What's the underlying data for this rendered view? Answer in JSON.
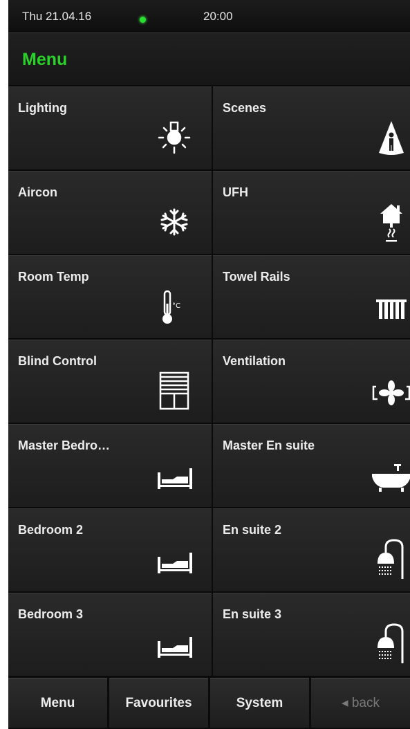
{
  "status": {
    "date": "Thu 21.04.16",
    "time": "20:00",
    "indicator_color": "#27e030"
  },
  "header": {
    "title": "Menu",
    "title_color": "#2ad12a"
  },
  "tiles": [
    {
      "label": "Lighting",
      "icon": "light-bulb-icon"
    },
    {
      "label": "Scenes",
      "icon": "scene-spotlight-icon"
    },
    {
      "label": "Aircon",
      "icon": "snowflake-icon"
    },
    {
      "label": "UFH",
      "icon": "underfloor-heating-icon"
    },
    {
      "label": "Room Temp",
      "icon": "thermometer-icon"
    },
    {
      "label": "Towel Rails",
      "icon": "towel-rail-icon"
    },
    {
      "label": "Blind Control",
      "icon": "blind-icon"
    },
    {
      "label": "Ventilation",
      "icon": "fan-icon"
    },
    {
      "label": "Master Bedro…",
      "icon": "bed-icon"
    },
    {
      "label": "Master En suite",
      "icon": "bathtub-icon"
    },
    {
      "label": "Bedroom 2",
      "icon": "bed-icon"
    },
    {
      "label": "En suite 2",
      "icon": "shower-icon"
    },
    {
      "label": "Bedroom 3",
      "icon": "bed-icon"
    },
    {
      "label": "En suite 3",
      "icon": "shower-icon"
    }
  ],
  "tabs": [
    {
      "label": "Menu"
    },
    {
      "label": "Favourites"
    },
    {
      "label": "System"
    },
    {
      "label": "◂ back"
    }
  ]
}
